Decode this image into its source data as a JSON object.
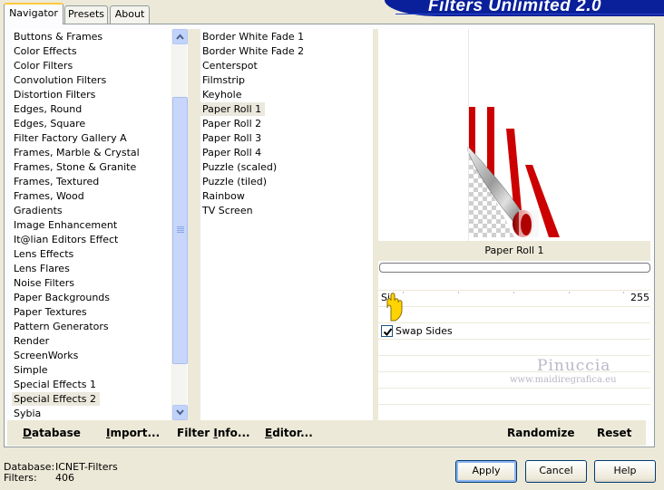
{
  "tabs": [
    {
      "label": "Navigator",
      "active": true
    },
    {
      "label": "Presets",
      "active": false
    },
    {
      "label": "About",
      "active": false
    }
  ],
  "banner": {
    "title": "Filters Unlimited 2.0",
    "color": "#0a1f9a"
  },
  "categories": [
    "Buttons & Frames",
    "Color Effects",
    "Color Filters",
    "Convolution Filters",
    "Distortion Filters",
    "Edges, Round",
    "Edges, Square",
    "Filter Factory Gallery A",
    "Frames, Marble & Crystal",
    "Frames, Stone & Granite",
    "Frames, Textured",
    "Frames, Wood",
    "Gradients",
    "Image Enhancement",
    "It@lian Editors Effect",
    "Lens Effects",
    "Lens Flares",
    "Noise Filters",
    "Paper Backgrounds",
    "Paper Textures",
    "Pattern Generators",
    "Render",
    "ScreenWorks",
    "Simple",
    "Special Effects 1",
    "Special Effects 2",
    "Sybia"
  ],
  "selected_category_index": 25,
  "filters": [
    "Border White Fade 1",
    "Border White Fade 2",
    "Centerspot",
    "Filmstrip",
    "Keyhole",
    "Paper Roll 1",
    "Paper Roll 2",
    "Paper Roll 3",
    "Paper Roll 4",
    "Puzzle (scaled)",
    "Puzzle (tiled)",
    "Rainbow",
    "TV Screen"
  ],
  "selected_filter_index": 5,
  "preview": {
    "filter_name": "Paper Roll 1",
    "accent_color": "#cc0000"
  },
  "parameters": {
    "slider_label": "Si",
    "slider_value": "255",
    "checkbox_label": "Swap Sides",
    "checkbox_checked": true
  },
  "watermark": {
    "name": "Pinuccia",
    "url": "www.maidiregrafica.eu"
  },
  "toolbar": {
    "database": {
      "ul": "D",
      "rest": "atabase"
    },
    "import": {
      "ul": "I",
      "rest": "mport..."
    },
    "filter_info": {
      "pre": "Filter ",
      "ul": "I",
      "rest": "nfo..."
    },
    "editor": {
      "ul": "E",
      "rest": "ditor..."
    },
    "randomize": "Randomize",
    "reset": "Reset"
  },
  "status": {
    "database_label": "Database:",
    "database_value": "ICNET-Filters",
    "filters_label": "Filters:",
    "filters_value": "406"
  },
  "buttons": {
    "apply": "Apply",
    "cancel": "Cancel",
    "help": "Help"
  }
}
